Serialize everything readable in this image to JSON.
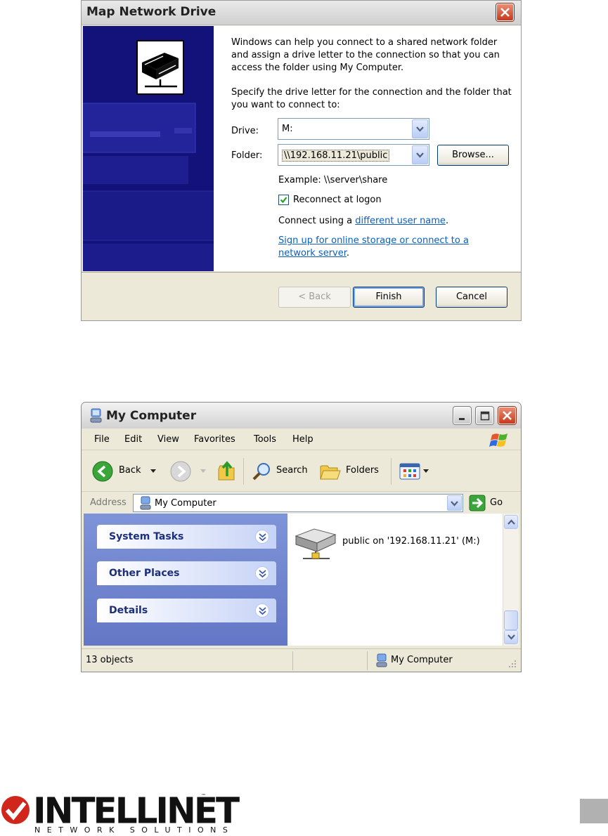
{
  "map_dialog": {
    "title": "Map Network Drive",
    "intro_text": "Windows can help you connect to a shared network folder and assign a drive letter to the connection so that you can access the folder using My Computer.",
    "specify_text": "Specify the drive letter for the connection and the folder that you want to connect to:",
    "drive_label": "Drive:",
    "drive_value": "M:",
    "folder_label": "Folder:",
    "folder_value": "\\\\192.168.11.21\\public",
    "browse_label": "Browse...",
    "example_text": "Example: \\\\server\\share",
    "reconnect_label": "Reconnect at logon",
    "reconnect_checked": true,
    "connect_prefix": "Connect using a ",
    "connect_link": "different user name",
    "connect_suffix": ".",
    "signup_link": "Sign up for online storage or connect to a network server",
    "signup_suffix": ".",
    "back_label": "< Back",
    "finish_label": "Finish",
    "cancel_label": "Cancel"
  },
  "my_computer": {
    "title": "My Computer",
    "menu": [
      "File",
      "Edit",
      "View",
      "Favorites",
      "Tools",
      "Help"
    ],
    "toolbar": {
      "back_label": "Back",
      "search_label": "Search",
      "folders_label": "Folders"
    },
    "address_label": "Address",
    "address_value": "My Computer",
    "go_label": "Go",
    "tasks": [
      "System Tasks",
      "Other Places",
      "Details"
    ],
    "file_item": "public on '192.168.11.21' (M:)",
    "status_count": "13 objects",
    "status_location": "My Computer"
  },
  "footer": {
    "brand": "INTELLINET",
    "tagline": "NETWORK SOLUTIONS",
    "trademark": "™"
  },
  "colors": {
    "xp_blue_panel": "#12127a",
    "link": "#0b5fbc",
    "close_button": "#c9381b",
    "task_pane": "#6e83cf"
  }
}
